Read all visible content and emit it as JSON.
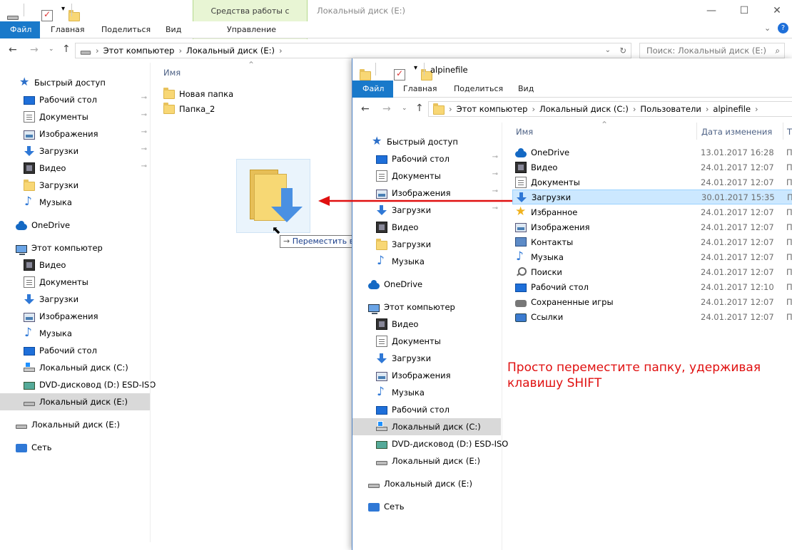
{
  "w1": {
    "context_tab_title": "Средства работы с дисками",
    "window_title": "Локальный диск (E:)",
    "tabs": [
      "Файл",
      "Главная",
      "Поделиться",
      "Вид",
      "Управление"
    ],
    "breadcrumb": [
      "Этот компьютер",
      "Локальный диск (E:)"
    ],
    "search_placeholder": "Поиск: Локальный диск (E:)",
    "column_name": "Имя",
    "files": [
      "Новая папка",
      "Папка_2"
    ],
    "nav": [
      {
        "label": "Быстрый доступ",
        "icon": "star-icon"
      },
      {
        "label": "Рабочий стол",
        "icon": "desktop-icon",
        "pinned": true
      },
      {
        "label": "Документы",
        "icon": "documents-icon",
        "pinned": true
      },
      {
        "label": "Изображения",
        "icon": "pictures-icon",
        "pinned": true
      },
      {
        "label": "Загрузки",
        "icon": "downloads-icon",
        "pinned": true
      },
      {
        "label": "Видео",
        "icon": "video-icon",
        "pinned": true
      },
      {
        "label": "Загрузки",
        "icon": "folder-icon"
      },
      {
        "label": "Музыка",
        "icon": "music-icon"
      },
      {
        "label": "OneDrive",
        "icon": "onedrive-icon"
      },
      {
        "label": "Этот компьютер",
        "icon": "computer-icon"
      },
      {
        "label": "Видео",
        "icon": "video-icon"
      },
      {
        "label": "Документы",
        "icon": "documents-icon"
      },
      {
        "label": "Загрузки",
        "icon": "downloads-icon"
      },
      {
        "label": "Изображения",
        "icon": "pictures-icon"
      },
      {
        "label": "Музыка",
        "icon": "music-icon"
      },
      {
        "label": "Рабочий стол",
        "icon": "desktop-icon"
      },
      {
        "label": "Локальный диск (C:)",
        "icon": "drive-c-icon"
      },
      {
        "label": "DVD-дисковод (D:) ESD-ISO",
        "icon": "dvd-icon"
      },
      {
        "label": "Локальный диск (E:)",
        "icon": "drive-icon",
        "selected": true
      },
      {
        "label": "Локальный диск (E:)",
        "icon": "drive-icon"
      },
      {
        "label": "Сеть",
        "icon": "network-icon"
      }
    ]
  },
  "drag_tooltip": "Переместить в \"Локальный диск (E:)\"",
  "annotation": "Просто переместите папку, удерживая клавишу SHIFT",
  "w2": {
    "window_title": "alpinefile",
    "tabs": [
      "Файл",
      "Главная",
      "Поделиться",
      "Вид"
    ],
    "breadcrumb": [
      "Этот компьютер",
      "Локальный диск (C:)",
      "Пользователи",
      "alpinefile"
    ],
    "col_name": "Имя",
    "col_date": "Дата изменения",
    "col_type": "Т",
    "files": [
      {
        "name": "OneDrive",
        "date": "13.01.2017 16:28",
        "icon": "onedrive-icon",
        "type": "П"
      },
      {
        "name": "Видео",
        "date": "24.01.2017 12:07",
        "icon": "video-icon",
        "type": "П"
      },
      {
        "name": "Документы",
        "date": "24.01.2017 12:07",
        "icon": "documents-icon",
        "type": "П"
      },
      {
        "name": "Загрузки",
        "date": "30.01.2017 15:35",
        "icon": "downloads-icon",
        "type": "П",
        "selected": true
      },
      {
        "name": "Избранное",
        "date": "24.01.2017 12:07",
        "icon": "favorites-icon",
        "type": "П"
      },
      {
        "name": "Изображения",
        "date": "24.01.2017 12:07",
        "icon": "pictures-icon",
        "type": "П"
      },
      {
        "name": "Контакты",
        "date": "24.01.2017 12:07",
        "icon": "contacts-icon",
        "type": "П"
      },
      {
        "name": "Музыка",
        "date": "24.01.2017 12:07",
        "icon": "music-icon",
        "type": "П"
      },
      {
        "name": "Поиски",
        "date": "24.01.2017 12:07",
        "icon": "search-folder-icon",
        "type": "П"
      },
      {
        "name": "Рабочий стол",
        "date": "24.01.2017 12:10",
        "icon": "desktop-icon",
        "type": "П"
      },
      {
        "name": "Сохраненные игры",
        "date": "24.01.2017 12:07",
        "icon": "saved-games-icon",
        "type": "П"
      },
      {
        "name": "Ссылки",
        "date": "24.01.2017 12:07",
        "icon": "links-icon",
        "type": "П"
      }
    ],
    "nav": [
      {
        "label": "Быстрый доступ",
        "icon": "star-icon"
      },
      {
        "label": "Рабочий стол",
        "icon": "desktop-icon",
        "pinned": true
      },
      {
        "label": "Документы",
        "icon": "documents-icon",
        "pinned": true
      },
      {
        "label": "Изображения",
        "icon": "pictures-icon",
        "pinned": true
      },
      {
        "label": "Загрузки",
        "icon": "downloads-icon",
        "pinned": true
      },
      {
        "label": "Видео",
        "icon": "video-icon"
      },
      {
        "label": "Загрузки",
        "icon": "folder-icon"
      },
      {
        "label": "Музыка",
        "icon": "music-icon"
      },
      {
        "label": "OneDrive",
        "icon": "onedrive-icon"
      },
      {
        "label": "Этот компьютер",
        "icon": "computer-icon"
      },
      {
        "label": "Видео",
        "icon": "video-icon"
      },
      {
        "label": "Документы",
        "icon": "documents-icon"
      },
      {
        "label": "Загрузки",
        "icon": "downloads-icon"
      },
      {
        "label": "Изображения",
        "icon": "pictures-icon"
      },
      {
        "label": "Музыка",
        "icon": "music-icon"
      },
      {
        "label": "Рабочий стол",
        "icon": "desktop-icon"
      },
      {
        "label": "Локальный диск (C:)",
        "icon": "drive-c-icon",
        "selected": true
      },
      {
        "label": "DVD-дисковод (D:) ESD-ISO",
        "icon": "dvd-icon"
      },
      {
        "label": "Локальный диск (E:)",
        "icon": "drive-icon"
      },
      {
        "label": "Локальный диск (E:)",
        "icon": "drive-icon"
      },
      {
        "label": "Сеть",
        "icon": "network-icon"
      }
    ]
  },
  "colors": {
    "accent": "#1979ca",
    "arrow": "#e01010",
    "annotation": "#e01010"
  }
}
